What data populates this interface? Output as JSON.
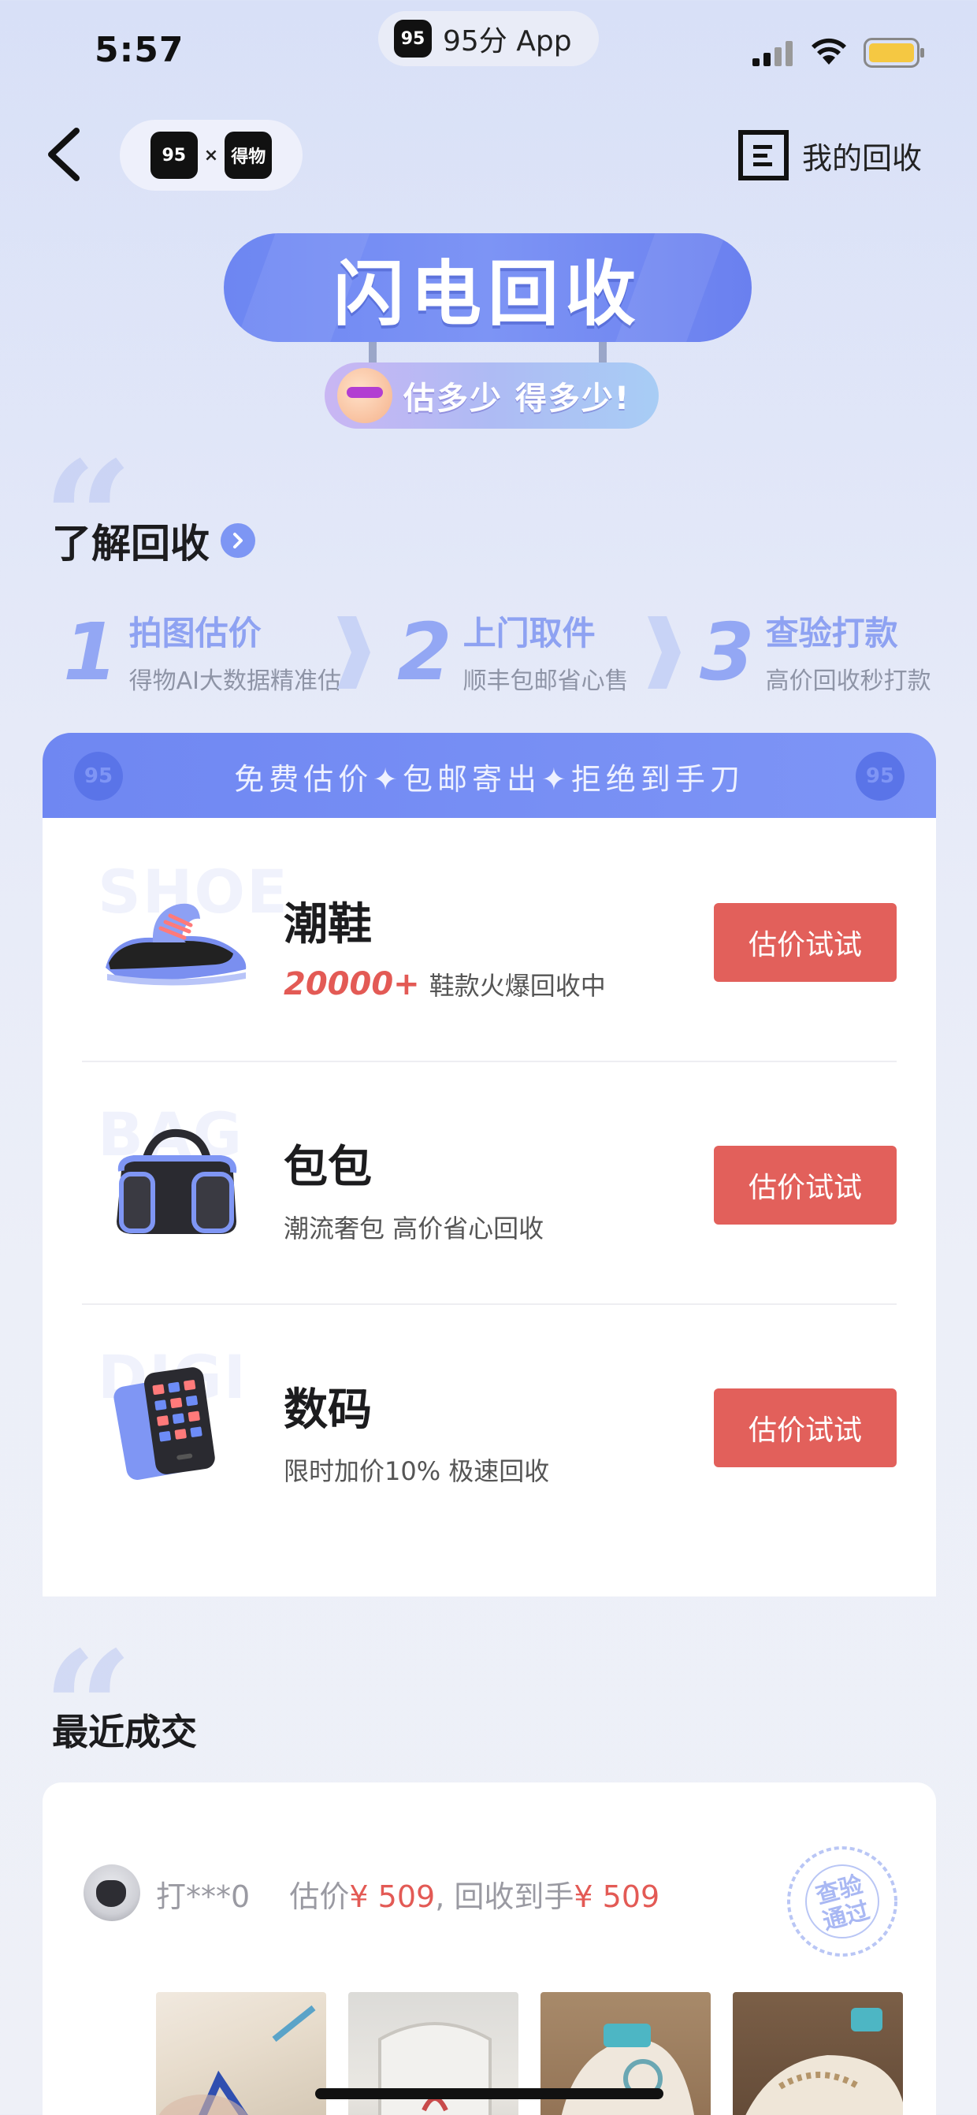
{
  "status_bar": {
    "time": "5:57",
    "app_pill_logo": "95",
    "app_pill_label": "95分 App"
  },
  "nav": {
    "brand_left": "95",
    "brand_x": "×",
    "brand_right": "得物",
    "my_recycle_label": "我的回收"
  },
  "hero": {
    "title": "闪电回收",
    "subtitle": "估多少 得多少!"
  },
  "learn_section": {
    "title": "了解回收",
    "steps": [
      {
        "num": "1",
        "title": "拍图估价",
        "desc": "得物AI大数据精准估"
      },
      {
        "num": "2",
        "title": "上门取件",
        "desc": "顺丰包邮省心售"
      },
      {
        "num": "3",
        "title": "查验打款",
        "desc": "高价回收秒打款"
      }
    ]
  },
  "categories_card": {
    "header_text": "免费估价✦包邮寄出✦拒绝到手刀",
    "header_badge": "95",
    "items": [
      {
        "watermark": "SHOE",
        "name": "潮鞋",
        "hot": "20000+",
        "desc": "鞋款火爆回收中",
        "button": "估价试试",
        "icon": "sneaker-icon"
      },
      {
        "watermark": "BAG",
        "name": "包包",
        "hot": "",
        "desc": "潮流奢包 高价省心回收",
        "button": "估价试试",
        "icon": "bag-icon"
      },
      {
        "watermark": "DIGI",
        "name": "数码",
        "hot": "",
        "desc": "限时加价10% 极速回收",
        "button": "估价试试",
        "icon": "phone-icon"
      }
    ]
  },
  "recent_section": {
    "title": "最近成交",
    "deal": {
      "user": "打***0",
      "estimate_label": "估价",
      "estimate_price": "¥ 509",
      "separator": ",",
      "received_label": "回收到手",
      "received_price": "¥ 509",
      "stamp_text": "查验\n通过"
    }
  },
  "colors": {
    "accent": "#7289f3",
    "button_red": "#e2605b",
    "hot_red": "#e35a55"
  }
}
